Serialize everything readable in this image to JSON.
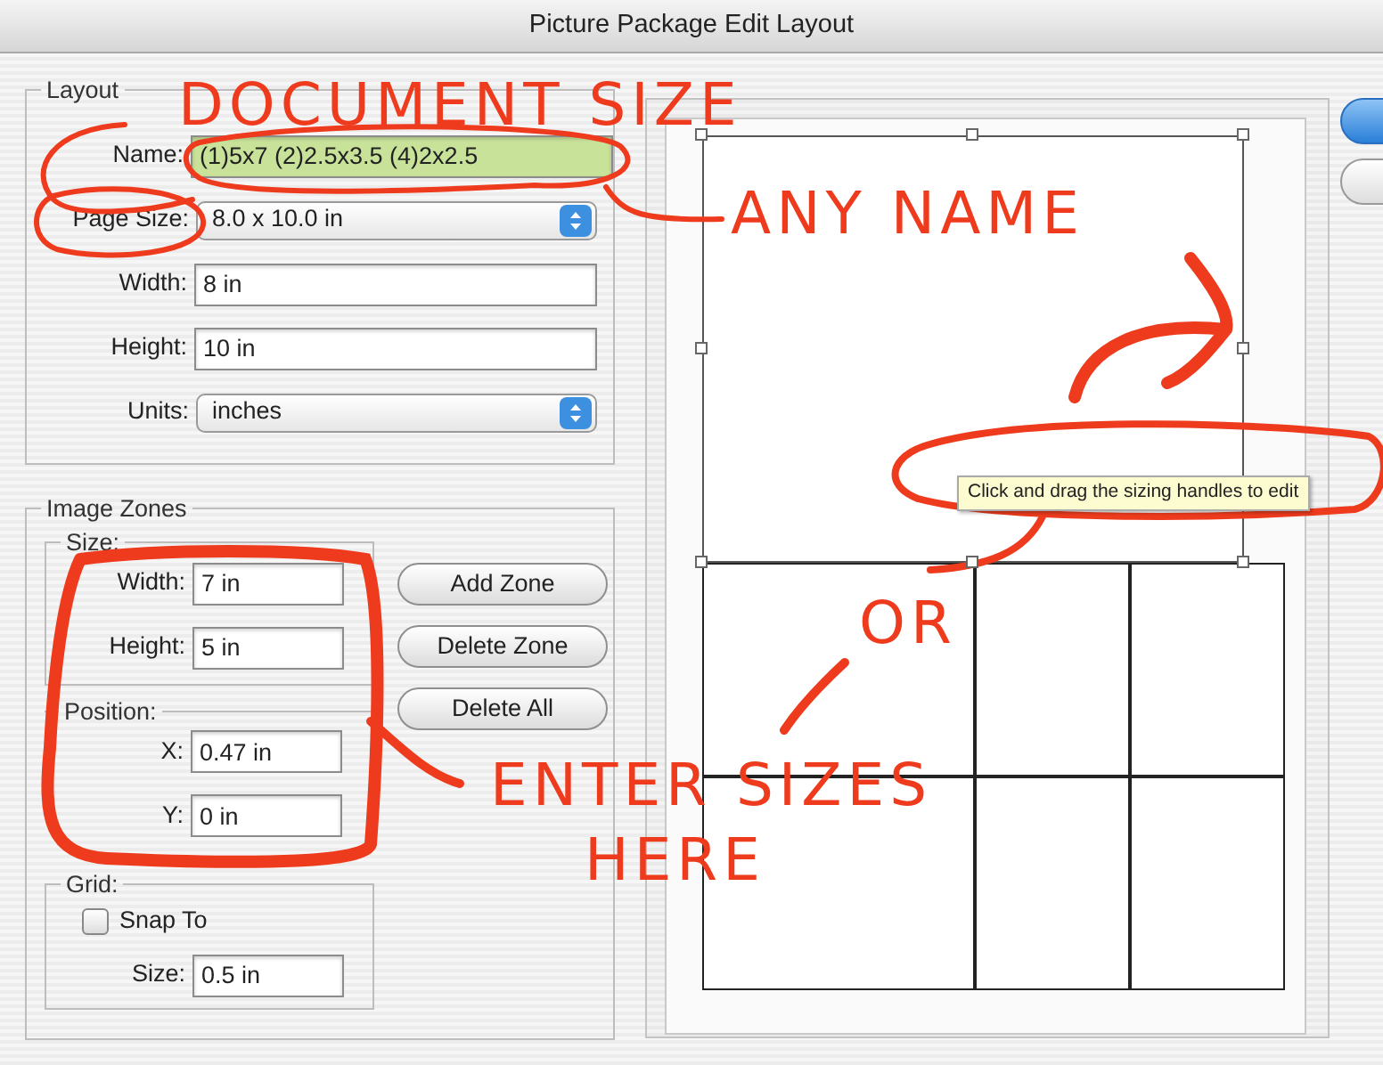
{
  "window": {
    "title": "Picture Package Edit Layout"
  },
  "layout": {
    "title": "Layout",
    "name": {
      "label": "Name:",
      "value": "(1)5x7 (2)2.5x3.5 (4)2x2.5",
      "highlighted": true
    },
    "page_size": {
      "label": "Page Size:",
      "value": "8.0 x 10.0 in"
    },
    "width": {
      "label": "Width:",
      "value": "8 in"
    },
    "height": {
      "label": "Height:",
      "value": "10 in"
    },
    "units": {
      "label": "Units:",
      "value": "inches"
    }
  },
  "image_zones": {
    "title": "Image Zones",
    "size": {
      "title": "Size:",
      "width": {
        "label": "Width:",
        "value": "7 in"
      },
      "height": {
        "label": "Height:",
        "value": "5 in"
      }
    },
    "position": {
      "title": "Position:",
      "x": {
        "label": "X:",
        "value": "0.47 in"
      },
      "y": {
        "label": "Y:",
        "value": "0 in"
      }
    },
    "grid": {
      "title": "Grid:",
      "snap_to": {
        "label": "Snap To",
        "checked": false
      },
      "size": {
        "label": "Size:",
        "value": "0.5 in"
      }
    },
    "buttons": [
      "Add Zone",
      "Delete Zone",
      "Delete All"
    ]
  },
  "preview": {
    "tooltip": "Click and drag the sizing handles to edit",
    "zones": [
      {
        "selected": true
      },
      {
        "selected": false
      },
      {
        "selected": false
      },
      {
        "selected": false
      },
      {
        "selected": false
      },
      {
        "selected": false
      },
      {
        "selected": false
      }
    ]
  },
  "annotations": [
    {
      "text": "DOCUMENT SIZE"
    },
    {
      "text": "ANY NAME"
    },
    {
      "text": "OR"
    },
    {
      "text": "ENTER SIZES"
    },
    {
      "text": "HERE"
    }
  ]
}
